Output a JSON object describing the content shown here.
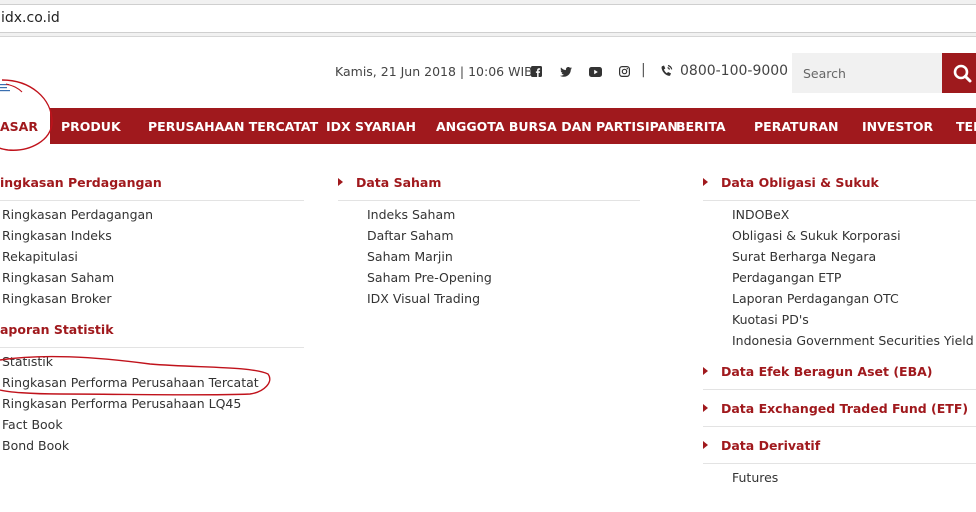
{
  "browser": {
    "url": "idx.co.id"
  },
  "topbar": {
    "datetime": "Kamis, 21 Jun 2018 | 10:06 WIB",
    "separator": "|",
    "phone": "0800-100-9000",
    "search_placeholder": "Search",
    "social_icons": [
      "facebook-icon",
      "twitter-icon",
      "youtube-icon",
      "instagram-icon"
    ]
  },
  "nav": {
    "active": "ASAR",
    "items": [
      "PRODUK",
      "PERUSAHAAN TERCATAT",
      "IDX SYARIAH",
      "ANGGOTA BURSA DAN PARTISIPAN",
      "BERITA",
      "PERATURAN",
      "INVESTOR",
      "TEN"
    ]
  },
  "menu": {
    "col1": {
      "head1": "ingkasan Perdagangan",
      "links1": [
        "Ringkasan Perdagangan",
        "Ringkasan Indeks",
        "Rekapitulasi",
        "Ringkasan Saham",
        "Ringkasan Broker"
      ],
      "head2": "aporan Statistik",
      "links2": [
        "Statistik",
        "Ringkasan Performa Perusahaan Tercatat",
        "Ringkasan Performa Perusahaan LQ45",
        "Fact Book",
        "Bond Book"
      ]
    },
    "col2": {
      "head": "Data Saham",
      "links": [
        "Indeks Saham",
        "Daftar Saham",
        "Saham Marjin",
        "Saham Pre-Opening",
        "IDX Visual Trading"
      ]
    },
    "col3": {
      "head1": "Data Obligasi & Sukuk",
      "links1": [
        "INDOBeX",
        "Obligasi & Sukuk Korporasi",
        "Surat Berharga Negara",
        "Perdagangan ETP",
        "Laporan Perdagangan OTC",
        "Kuotasi PD's",
        "Indonesia Government Securities Yield Curve"
      ],
      "head2": "Data Efek Beragun Aset (EBA)",
      "head3": "Data Exchanged Traded Fund (ETF)",
      "head4": "Data Derivatif",
      "links4": [
        "Futures"
      ]
    }
  },
  "colors": {
    "brand_red": "#a0191d",
    "annotation_red": "#c0121b"
  }
}
